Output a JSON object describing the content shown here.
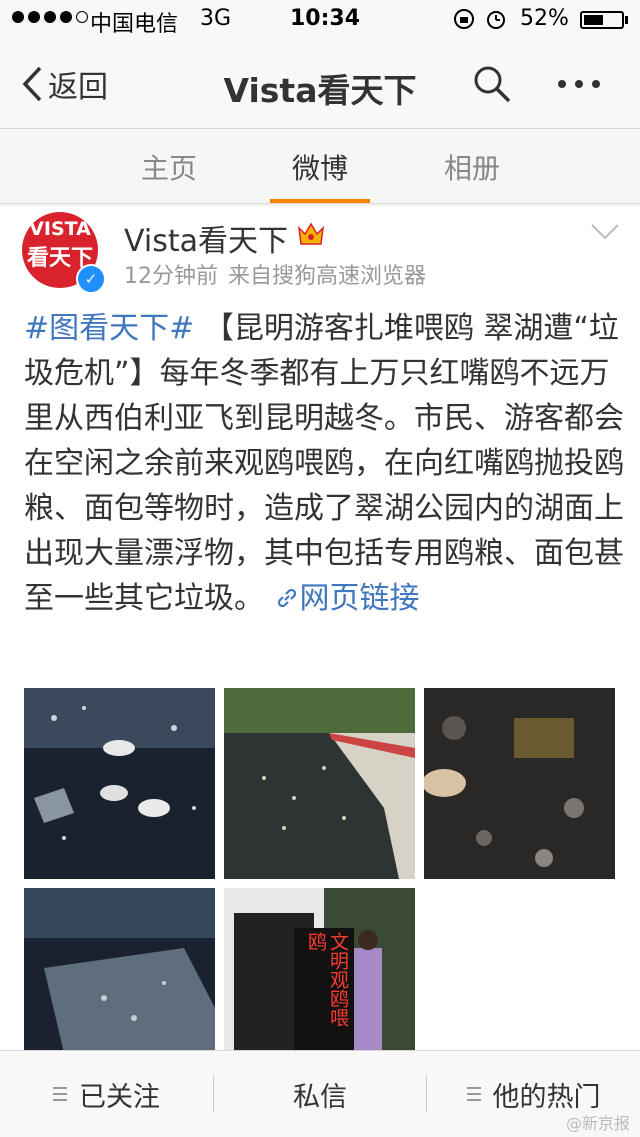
{
  "status_bar": {
    "carrier": "中国电信",
    "network": "3G",
    "time": "10:34",
    "battery_percent": "52%",
    "battery_level": 0.52,
    "signal_bars": 4
  },
  "nav": {
    "back_label": "返回",
    "title": "Vista看天下",
    "search_icon": "search-icon",
    "more_icon": "more-icon"
  },
  "tabs": [
    {
      "label": "主页",
      "active": false
    },
    {
      "label": "微博",
      "active": true
    },
    {
      "label": "相册",
      "active": false
    }
  ],
  "accent_color": "#ff8200",
  "post": {
    "avatar_text_1": "VISTA",
    "avatar_text_2": "看天下",
    "username": "Vista看天下",
    "time_ago": "12分钟前",
    "source": "来自搜狗高速浏览器",
    "topic": "#图看天下#",
    "body": "【昆明游客扎堆喂鸥 翠湖遭“垃圾危机”】每年冬季都有上万只红嘴鸥不远万里从西伯利亚飞到昆明越冬。市民、游客都会在空闲之余前来观鸥喂鸥，在向红嘴鸥抛投鸥粮、面包等物时，造成了翠湖公园内的湖面上出现大量漂浮物，其中包括专用鸥粮、面包甚至一些其它垃圾。",
    "link_label": "网页链接",
    "photo_sign_text": "文明观鸥喂鸥"
  },
  "bottom_bar": {
    "follow_label": "已关注",
    "message_label": "私信",
    "hot_label": "他的热门"
  },
  "watermark": "@新京报"
}
